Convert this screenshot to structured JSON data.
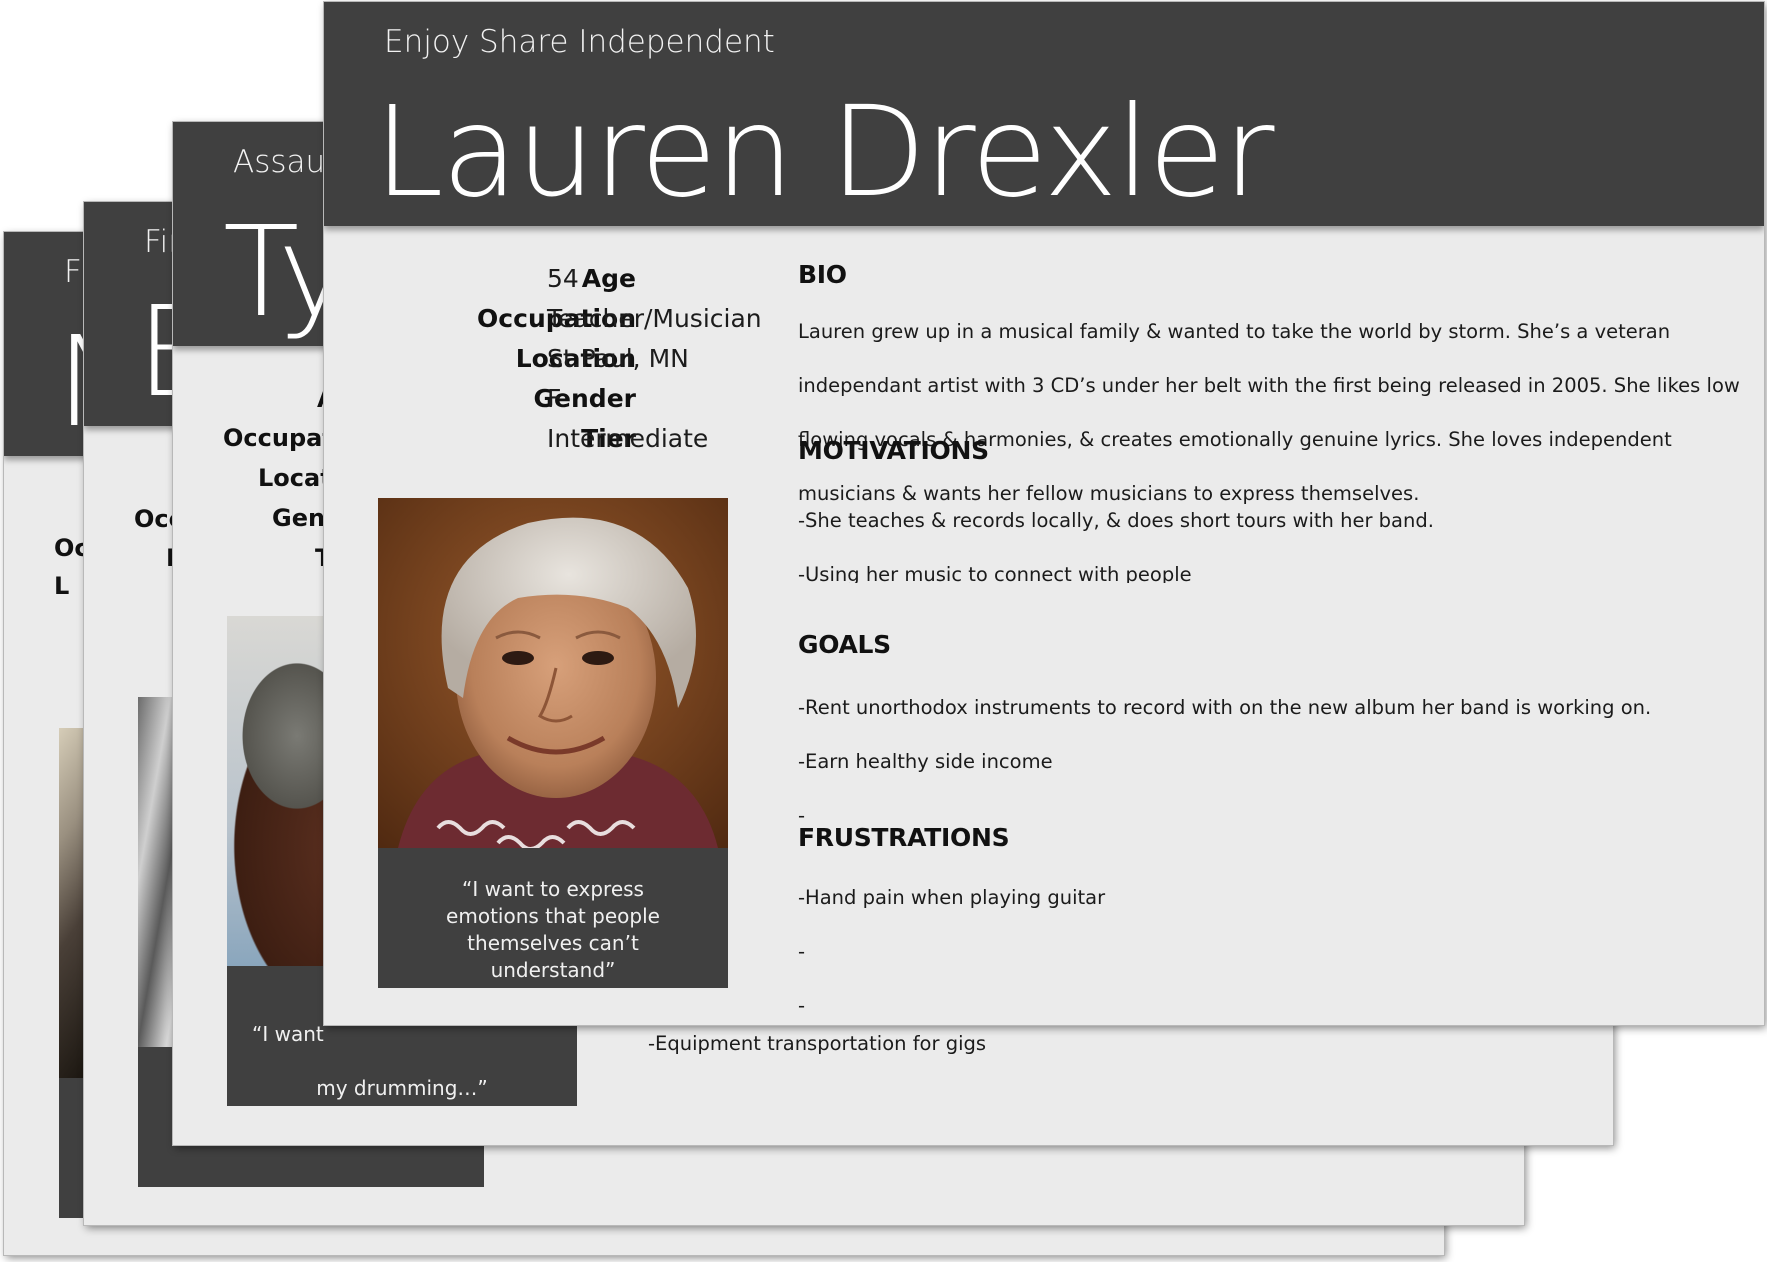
{
  "cards": {
    "card1": {
      "tagline": "Fu",
      "name": "N",
      "labels": [
        "Oc",
        "L"
      ]
    },
    "card2": {
      "tagline": "Fir",
      "name": "B",
      "labels": [
        "Occ",
        "L"
      ]
    },
    "card3": {
      "tagline": "Assaul",
      "name": "Ty",
      "labels": [
        "A",
        "Occupat",
        "Locat",
        "Gen",
        "T"
      ],
      "quote": "“I want",
      "quote2": "my drumming…”",
      "frustration": "-Equipment transportation for gigs"
    },
    "main": {
      "tagline": "Enjoy Share Independent",
      "name": "Lauren Drexler",
      "attributes": [
        {
          "label": "Age",
          "value": "54"
        },
        {
          "label": "Occupation",
          "value": "Teacher/Musician"
        },
        {
          "label": "Location",
          "value": "St.Paul, MN"
        },
        {
          "label": "Gender",
          "value": "F"
        },
        {
          "label": "Tier",
          "value": "Intermediate"
        }
      ],
      "quote": "“I want to express emotions that people themselves can’t understand”",
      "bio": {
        "title": "BIO",
        "lines": [
          "Lauren grew up in a musical family & wanted to take the world by storm. She’s a veteran",
          "independant artist with 3 CD’s under her belt with the first being released in 2005. She likes low",
          "flowing vocals & harmonies, & creates emotionally genuine lyrics. She loves independent",
          "musicians & wants her fellow musicians to express themselves."
        ]
      },
      "motivations": {
        "title": "MOTIVATIONS",
        "lines": [
          "-She teaches & records locally, & does short tours with her band.",
          "-Using her music to connect with people"
        ]
      },
      "goals": {
        "title": "GOALS",
        "lines": [
          "-Rent unorthodox instruments to record with on the new album her band is working on.",
          "-Earn healthy side income",
          "-"
        ]
      },
      "frustrations": {
        "title": "FRUSTRATIONS",
        "lines": [
          "-Hand pain when playing guitar",
          "-",
          "-"
        ]
      }
    }
  },
  "colors": {
    "header": "#404040",
    "card_bg": "#ebebeb"
  }
}
